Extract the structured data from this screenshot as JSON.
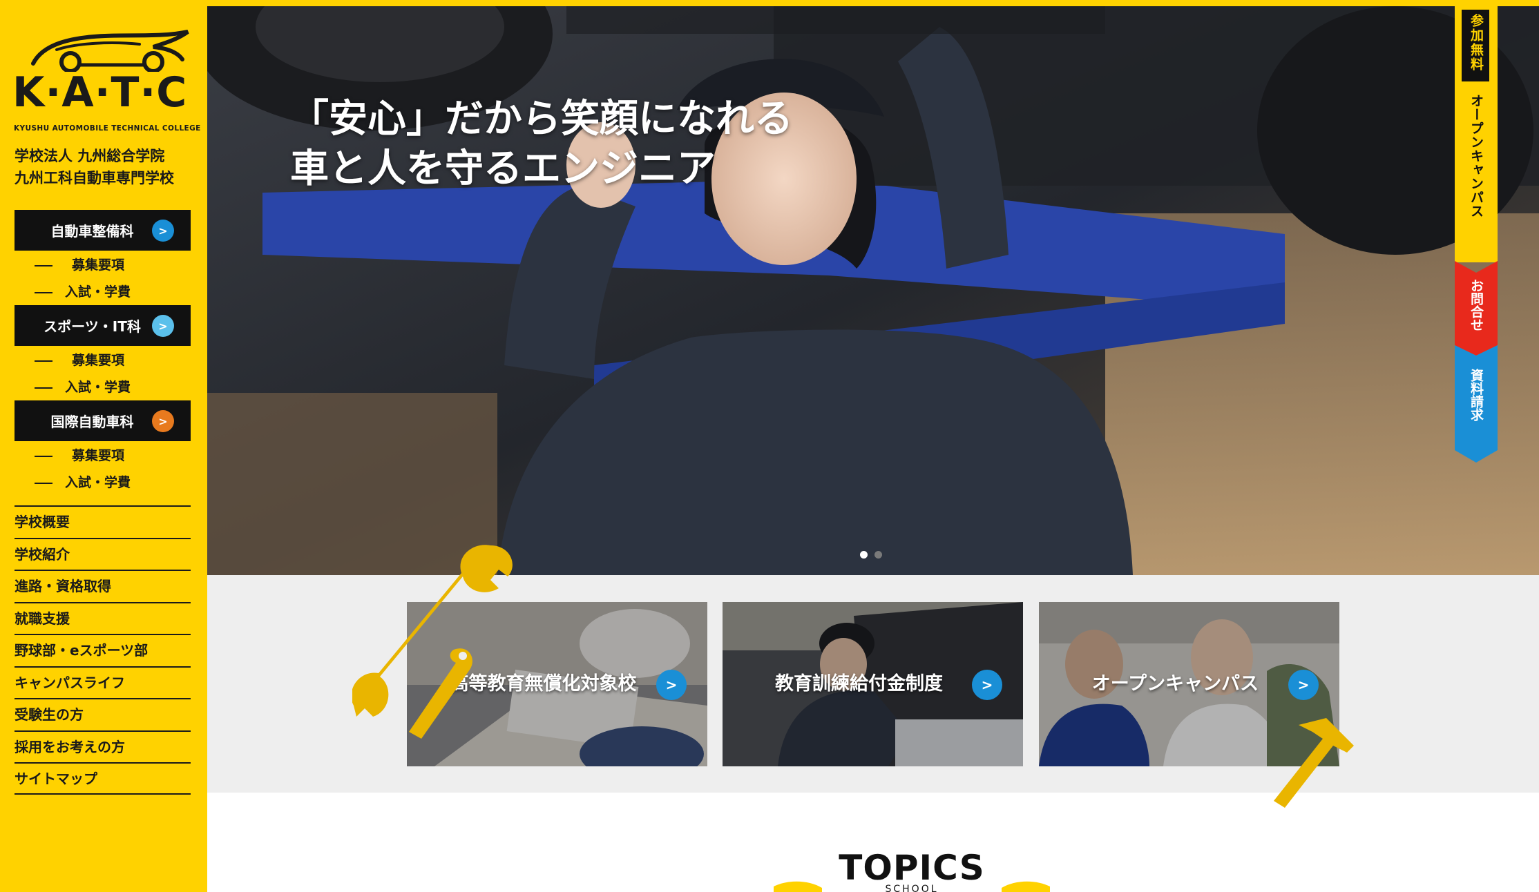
{
  "brand": {
    "logo_text": "K·A·T·C",
    "logo_sub": "KYUSHU AUTOMOBILE TECHNICAL COLLEGE",
    "school_line1": "学校法人 九州総合学院",
    "school_line2": "九州工科自動車専門学校"
  },
  "departments": [
    {
      "label": "自動車整備科",
      "arrow": ">",
      "accent": "#1a8fd6",
      "sub1": "募集要項",
      "sub2": "入試・学費"
    },
    {
      "label": "スポーツ・IT科",
      "arrow": ">",
      "accent": "#5bc0eb",
      "sub1": "募集要項",
      "sub2": "入試・学費"
    },
    {
      "label": "国際自動車科",
      "arrow": ">",
      "accent": "#e87a1e",
      "sub1": "募集要項",
      "sub2": "入試・学費"
    }
  ],
  "nav": [
    "学校概要",
    "学校紹介",
    "進路・資格取得",
    "就職支援",
    "野球部・eスポーツ部",
    "キャンパスライフ",
    "受験生の方",
    "採用をお考えの方",
    "サイトマップ"
  ],
  "hero": {
    "line1": "「安心」だから笑顔になれる",
    "line2": "車と人を守るエンジニア",
    "slide_count": 2,
    "active_slide": 1
  },
  "side_tabs": {
    "free_label": "参加無料",
    "open_campus": "オープンキャンパス",
    "contact": "お問合せ",
    "brochure": "資料請求"
  },
  "cards": [
    {
      "label": "高等教育無償化対象校",
      "arrow": ">"
    },
    {
      "label": "教育訓練給付金制度",
      "arrow": ">"
    },
    {
      "label": "オープンキャンパス",
      "arrow": ">"
    }
  ],
  "topics": {
    "title": "TOPICS",
    "subtitle": "SCHOOL"
  },
  "colors": {
    "yellow": "#ffd200",
    "black": "#111111",
    "blue": "#1a8fd6",
    "red": "#e8291c",
    "orange": "#e87a1e"
  }
}
